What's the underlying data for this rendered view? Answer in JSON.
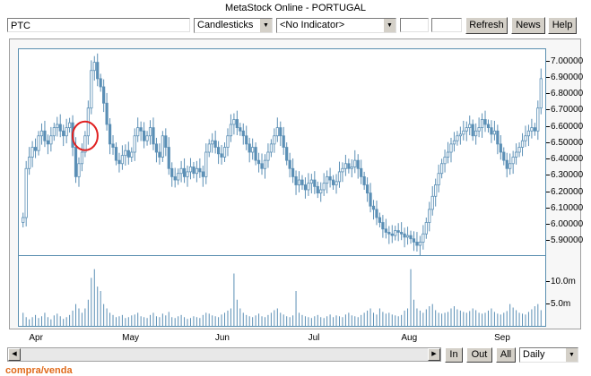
{
  "window": {
    "title": "MetaStock Online - PORTUGAL"
  },
  "toolbar": {
    "symbol_value": "PTC",
    "chart_type": "Candlesticks",
    "indicator": "<No Indicator>",
    "field1": "",
    "field2": "",
    "refresh_label": "Refresh",
    "news_label": "News",
    "help_label": "Help"
  },
  "bottom": {
    "in_label": "In",
    "out_label": "Out",
    "all_label": "All",
    "period": "Daily"
  },
  "footer_text": "compra/venda",
  "colors": {
    "candle": "#5b8fb5",
    "annotation": "#e02020",
    "volume": "#5b8fb5"
  },
  "chart_data": {
    "type": "candlestick",
    "title": "",
    "price_ticks": [
      "7.00000",
      "6.90000",
      "6.80000",
      "6.70000",
      "6.60000",
      "6.50000",
      "6.40000",
      "6.30000",
      "6.20000",
      "6.10000",
      "6.00000",
      "5.90000"
    ],
    "price_tick_values": [
      7.0,
      6.9,
      6.8,
      6.7,
      6.6,
      6.5,
      6.4,
      6.3,
      6.2,
      6.1,
      6.0,
      5.9
    ],
    "ylim": [
      5.82,
      7.08
    ],
    "volume_ticks": [
      "10.0m",
      "5.0m"
    ],
    "volume_tick_values": [
      10,
      5
    ],
    "volume_ylim": [
      0,
      16
    ],
    "months": [
      "Apr",
      "May",
      "Jun",
      "Jul",
      "Aug",
      "Sep"
    ],
    "annotations": [
      {
        "shape": "circle",
        "near": "Apr peak area",
        "index": 20
      },
      {
        "shape": "circle",
        "near": "latest sessions",
        "index": 175
      }
    ],
    "close": [
      6.05,
      6.35,
      6.42,
      6.48,
      6.46,
      6.55,
      6.58,
      6.52,
      6.5,
      6.55,
      6.6,
      6.62,
      6.58,
      6.55,
      6.6,
      6.63,
      6.48,
      6.3,
      6.38,
      6.45,
      6.55,
      6.72,
      6.95,
      7.0,
      6.9,
      6.85,
      6.75,
      6.62,
      6.5,
      6.48,
      6.4,
      6.38,
      6.43,
      6.46,
      6.42,
      6.45,
      6.55,
      6.6,
      6.58,
      6.52,
      6.55,
      6.6,
      6.5,
      6.45,
      6.42,
      6.55,
      6.48,
      6.35,
      6.3,
      6.28,
      6.32,
      6.35,
      6.3,
      6.33,
      6.36,
      6.32,
      6.35,
      6.33,
      6.3,
      6.45,
      6.5,
      6.52,
      6.48,
      6.44,
      6.42,
      6.48,
      6.55,
      6.62,
      6.65,
      6.6,
      6.58,
      6.55,
      6.5,
      6.45,
      6.48,
      6.4,
      6.38,
      6.35,
      6.4,
      6.45,
      6.5,
      6.55,
      6.6,
      6.55,
      6.48,
      6.4,
      6.35,
      6.3,
      6.25,
      6.28,
      6.25,
      6.22,
      6.26,
      6.28,
      6.24,
      6.2,
      6.22,
      6.26,
      6.3,
      6.28,
      6.25,
      6.27,
      6.33,
      6.35,
      6.38,
      6.35,
      6.36,
      6.4,
      6.35,
      6.3,
      6.25,
      6.2,
      6.12,
      6.1,
      6.05,
      6.02,
      5.98,
      5.96,
      5.95,
      5.94,
      5.97,
      5.96,
      5.95,
      5.93,
      5.94,
      5.92,
      5.9,
      5.88,
      5.9,
      5.95,
      6.02,
      6.1,
      6.18,
      6.25,
      6.32,
      6.38,
      6.42,
      6.45,
      6.5,
      6.52,
      6.55,
      6.56,
      6.58,
      6.6,
      6.62,
      6.55,
      6.58,
      6.6,
      6.65,
      6.62,
      6.6,
      6.56,
      6.58,
      6.5,
      6.45,
      6.4,
      6.35,
      6.38,
      6.42,
      6.45,
      6.48,
      6.52,
      6.55,
      6.58,
      6.6,
      6.58,
      6.72,
      6.9
    ],
    "volume": [
      3,
      2,
      1.5,
      2,
      2.5,
      1.8,
      2.2,
      3,
      2,
      1.5,
      2.4,
      2.8,
      2.2,
      1.6,
      2,
      2.5,
      3.5,
      5,
      4,
      3,
      4,
      6,
      11,
      13,
      9,
      8,
      5,
      4,
      3,
      2.5,
      2,
      2.2,
      2.5,
      1.8,
      2,
      2.4,
      2.6,
      3,
      2.2,
      2,
      1.8,
      2.5,
      3,
      2.2,
      2,
      2.8,
      2.4,
      3.2,
      2,
      1.8,
      2.2,
      2.5,
      2,
      1.6,
      1.8,
      2.2,
      2,
      1.8,
      2.5,
      3,
      2.8,
      2.4,
      2.2,
      2,
      2.6,
      3,
      3.5,
      4,
      12,
      6,
      4,
      3,
      2.5,
      2.2,
      2,
      2.4,
      2.8,
      2.2,
      2,
      2.5,
      3,
      3.6,
      4,
      3,
      2.6,
      2.2,
      2,
      2.4,
      8,
      3,
      2.5,
      2.2,
      2,
      1.8,
      2.2,
      2.5,
      2,
      1.8,
      2.2,
      2.6,
      2,
      2.4,
      2.2,
      2,
      2.6,
      3,
      2.4,
      2.2,
      2,
      2.5,
      3,
      3.5,
      4,
      3,
      2.6,
      4,
      3.2,
      2.8,
      3,
      2.6,
      2.4,
      2.2,
      2.5,
      3.5,
      4,
      13,
      6,
      4,
      3.5,
      3,
      3.8,
      4.5,
      5,
      3.6,
      3,
      2.8,
      3,
      3.2,
      4,
      4.5,
      3.8,
      3.5,
      3.2,
      3,
      3.4,
      4,
      3.6,
      3,
      2.8,
      3,
      3.5,
      4,
      3.2,
      2.8,
      2.6,
      3,
      3.4,
      5,
      4.2,
      3.6,
      3,
      2.8,
      2.6,
      3.2,
      3.8,
      4.5,
      5,
      3.6,
      3.2,
      3,
      4,
      11
    ]
  }
}
